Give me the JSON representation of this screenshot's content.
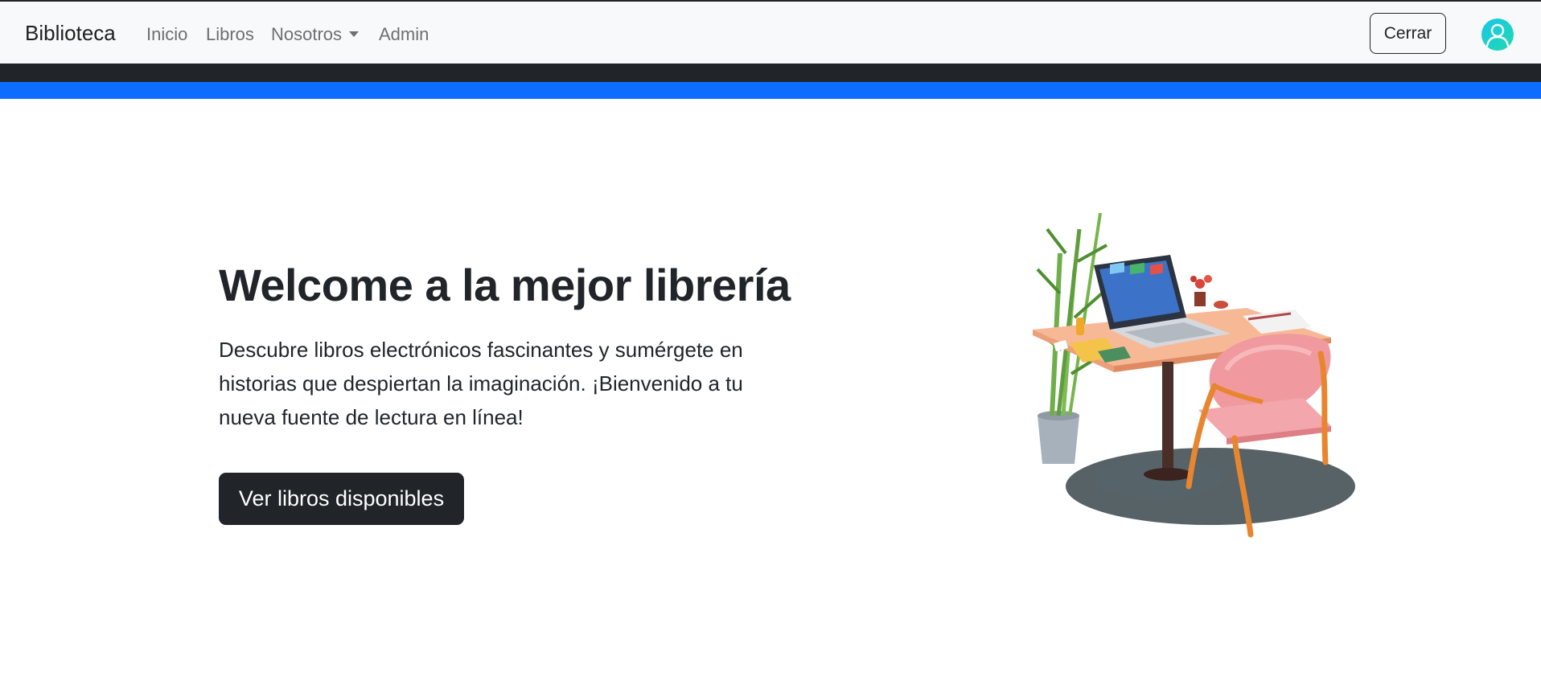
{
  "navbar": {
    "brand": "Biblioteca",
    "links": {
      "inicio": "Inicio",
      "libros": "Libros",
      "nosotros": "Nosotros",
      "admin": "Admin"
    },
    "logout_label": "Cerrar",
    "avatar_icon": "user-circle-icon"
  },
  "hero": {
    "title": "Welcome a la mejor librería",
    "lead": "Descubre libros electrónicos fascinantes y sumérgete en historias que despiertan la imaginación. ¡Bienvenido a tu nueva fuente de lectura en línea!",
    "button_label": "Ver libros disponibles",
    "image_icon": "desk-workspace-illustration"
  },
  "colors": {
    "navbar_bg": "#f8f9fa",
    "dark_band": "#212529",
    "blue_band": "#0d6efd",
    "button_dark": "#212529",
    "avatar": "#19c7e8"
  }
}
